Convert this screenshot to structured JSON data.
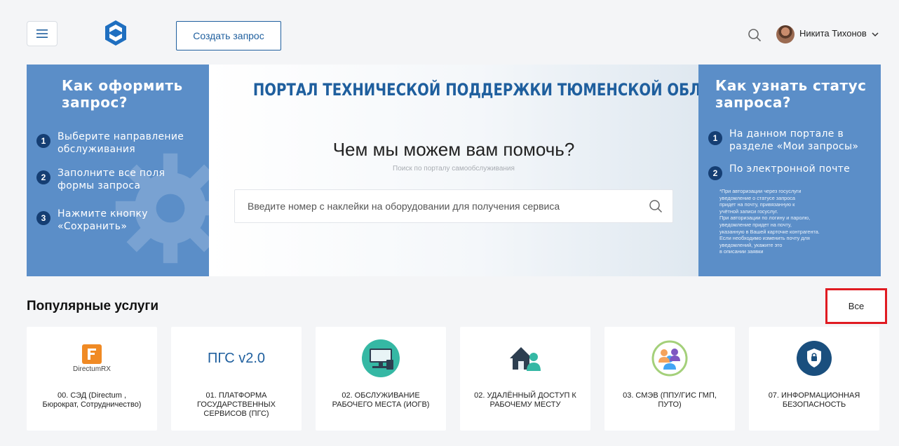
{
  "header": {
    "create_button_label": "Создать запрос",
    "user_name": "Никита Тихонов"
  },
  "banner": {
    "left_panel": {
      "title_line1": "Как оформить",
      "title_line2": "запрос?",
      "steps": [
        {
          "num": "1",
          "line1": "Выберите направление",
          "line2": "обслуживания"
        },
        {
          "num": "2",
          "line1": "Заполните все поля",
          "line2": "формы запроса"
        },
        {
          "num": "3",
          "line1": "Нажмите кнопку",
          "line2": "«Сохранить»"
        }
      ]
    },
    "center": {
      "portal_title": "ПОРТАЛ ТЕХНИЧЕСКОЙ ПОДДЕРЖКИ ТЮМЕНСКОЙ ОБЛАСТИ",
      "help_title": "Чем мы можем вам помочь?",
      "help_subtitle": "Поиск по порталу самообслуживания",
      "search_placeholder": "Введите номер с наклейки на оборудовании для получения сервиса"
    },
    "right_panel": {
      "title_line1": "Как узнать статус",
      "title_line2": "запроса?",
      "steps": [
        {
          "num": "1",
          "line1": "На данном портале в",
          "line2": "разделе «Мои запросы»"
        },
        {
          "num": "2",
          "line1": "По электронной почте",
          "line2": ""
        }
      ],
      "note_lines": [
        "*При авторизации через госуслуги",
        "уведомление о статусе запроса",
        "придет на почту, привязанную к",
        "учётной записи госуслуг.",
        "При авторизации по логину и паролю,",
        "уведомление придет на почту,",
        "указанную в Вашей карточке контрагента.",
        "Если необходимо изменить почту для",
        "уведомлений, укажите это",
        "в описании заявки"
      ]
    }
  },
  "popular": {
    "title": "Популярные услуги",
    "all_button_label": "Все",
    "cards": [
      {
        "icon": "directum-rx-logo",
        "icon_text": "DirectumRX",
        "line1": "00. СЭД (Directum ,",
        "line2": "Бюрократ, Сотрудничество)",
        "line3": ""
      },
      {
        "icon": "pgs-logo",
        "icon_text": "ПГС v2.0",
        "line1": "01. ПЛАТФОРМА",
        "line2": "ГОСУДАРСТВЕННЫХ",
        "line3": "СЕРВИСОВ (ПГС)"
      },
      {
        "icon": "workstation-icon",
        "icon_text": "",
        "line1": "02. ОБСЛУЖИВАНИЕ",
        "line2": "РАБОЧЕГО МЕСТА (ИОГВ)",
        "line3": ""
      },
      {
        "icon": "remote-access-icon",
        "icon_text": "",
        "line1": "02. УДАЛЁННЫЙ ДОСТУП К",
        "line2": "РАБОЧЕМУ МЕСТУ",
        "line3": ""
      },
      {
        "icon": "people-group-icon",
        "icon_text": "",
        "line1": "03. СМЭВ (ППУ/ГИС ГМП,",
        "line2": "ПУТО)",
        "line3": ""
      },
      {
        "icon": "security-shield-icon",
        "icon_text": "",
        "line1": "07. ИНФОРМАЦИОННАЯ",
        "line2": "БЕЗОПАСНОСТЬ",
        "line3": ""
      }
    ]
  },
  "colors": {
    "brand_blue": "#1f5f9e",
    "panel_blue": "#5b8ec8",
    "step_badge": "#153e73",
    "highlight_red": "#e01b22"
  }
}
